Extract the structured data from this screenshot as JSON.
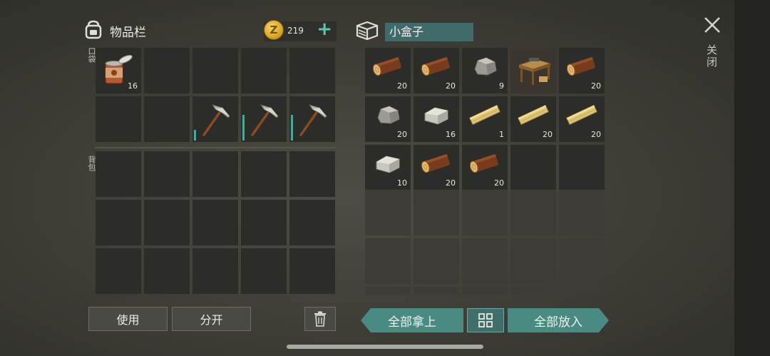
{
  "inventory": {
    "title": "物品栏",
    "coins": "219",
    "coin_symbol": "Z",
    "pocket_label": "口袋",
    "backpack_label": "背包",
    "pocket_slots": [
      {
        "item": "canned-food-icon",
        "count": "16"
      },
      {
        "item": "",
        "count": ""
      },
      {
        "item": "",
        "count": ""
      },
      {
        "item": "",
        "count": ""
      },
      {
        "item": "",
        "count": ""
      },
      {
        "item": "",
        "count": ""
      },
      {
        "item": "",
        "count": ""
      },
      {
        "item": "pickaxe-icon",
        "count": "",
        "durability": 0.25
      },
      {
        "item": "pickaxe-icon",
        "count": "",
        "durability": 0.6
      },
      {
        "item": "pickaxe-icon",
        "count": "",
        "durability": 0.6
      }
    ],
    "backpack_slot_count": 15
  },
  "box": {
    "title": "小盒子",
    "slots": [
      {
        "item": "log-icon",
        "count": "20"
      },
      {
        "item": "log-icon",
        "count": "20"
      },
      {
        "item": "stone-icon",
        "count": "9"
      },
      {
        "item": "workbench-icon",
        "count": ""
      },
      {
        "item": "log-icon",
        "count": "20"
      },
      {
        "item": "stone-icon",
        "count": "20"
      },
      {
        "item": "limestone-icon",
        "count": "16"
      },
      {
        "item": "plank-icon",
        "count": "1"
      },
      {
        "item": "plank-icon",
        "count": "20"
      },
      {
        "item": "plank-icon",
        "count": "20"
      },
      {
        "item": "limestone-icon",
        "count": "10"
      },
      {
        "item": "log-icon",
        "count": "20"
      },
      {
        "item": "log-icon",
        "count": "20"
      },
      {
        "item": "",
        "count": ""
      },
      {
        "item": "",
        "count": ""
      }
    ],
    "locked_rows": 3
  },
  "buttons": {
    "use": "使用",
    "split": "分开",
    "take_all": "全部拿上",
    "put_all": "全部放入",
    "close": "关闭"
  },
  "colors": {
    "accent": "#4b8a83",
    "title_field": "#406b6a",
    "plus": "#5fc3b0"
  }
}
